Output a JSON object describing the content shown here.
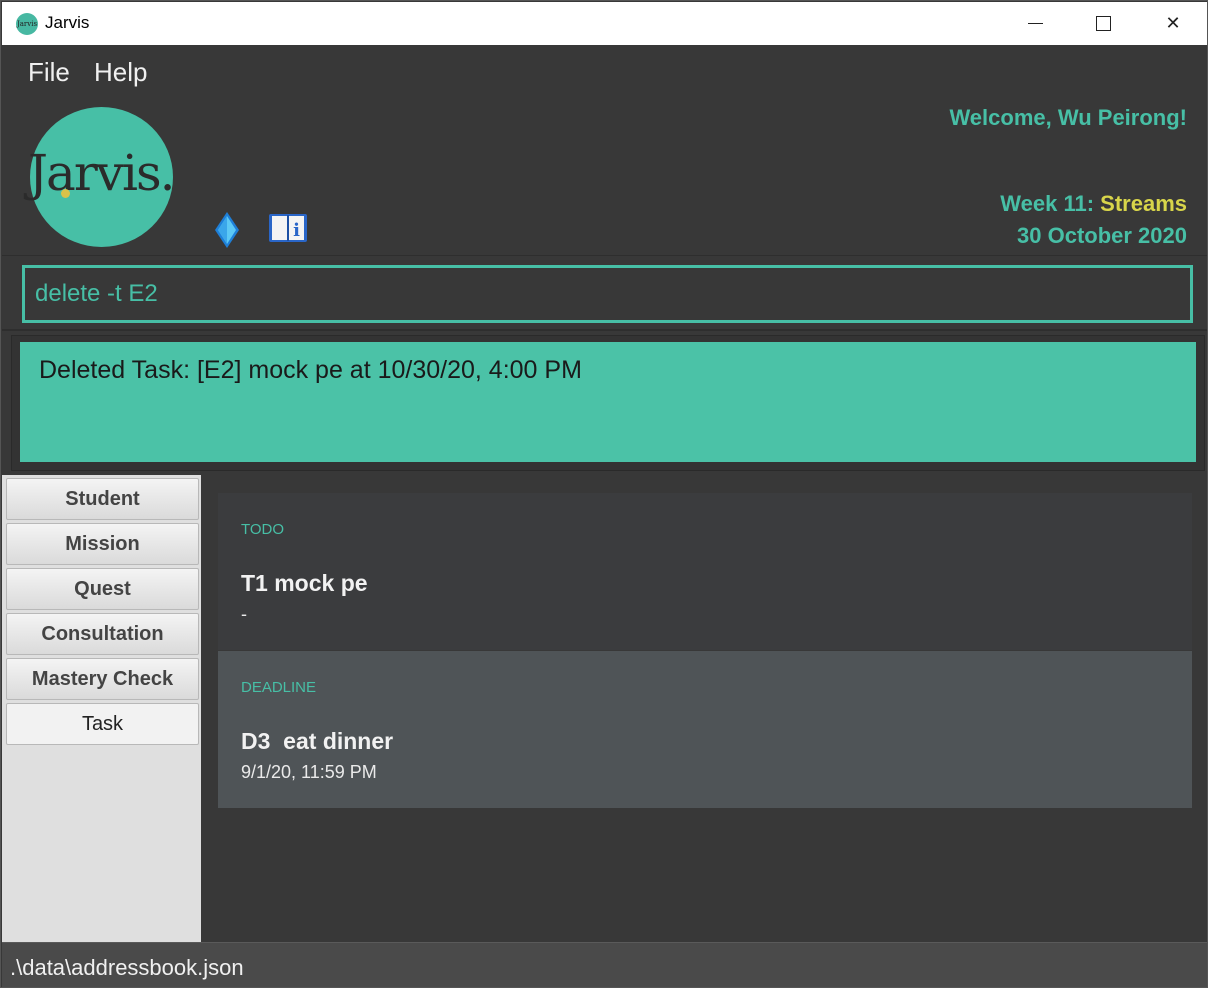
{
  "window": {
    "title": "Jarvis",
    "title_icon_text": "Jarvis"
  },
  "menu": {
    "file": "File",
    "help": "Help"
  },
  "header": {
    "logo_text": "Jarvis.",
    "welcome": "Welcome, Wu Peirong!",
    "week_prefix": "Week 11: ",
    "week_topic": "Streams",
    "date": "30 October 2020",
    "icons": [
      "gem-icon",
      "book-info-icon"
    ]
  },
  "command": {
    "value": "delete -t E2"
  },
  "result": {
    "text": "Deleted Task: [E2] mock pe at 10/30/20, 4:00 PM"
  },
  "sidebar": {
    "items": [
      {
        "label": "Student"
      },
      {
        "label": "Mission"
      },
      {
        "label": "Quest"
      },
      {
        "label": "Consultation"
      },
      {
        "label": "Mastery Check"
      },
      {
        "label": "Task"
      }
    ],
    "active": "Task"
  },
  "tasks": [
    {
      "type": "TODO",
      "title": "T1 mock pe",
      "detail": "-"
    },
    {
      "type": "DEADLINE",
      "title": "D3  eat dinner",
      "detail": "9/1/20, 11:59 PM"
    }
  ],
  "status": {
    "path": ".\\data\\addressbook.json"
  },
  "colors": {
    "accent": "#47bfa6",
    "topic": "#d8d54a",
    "background": "#383838"
  }
}
